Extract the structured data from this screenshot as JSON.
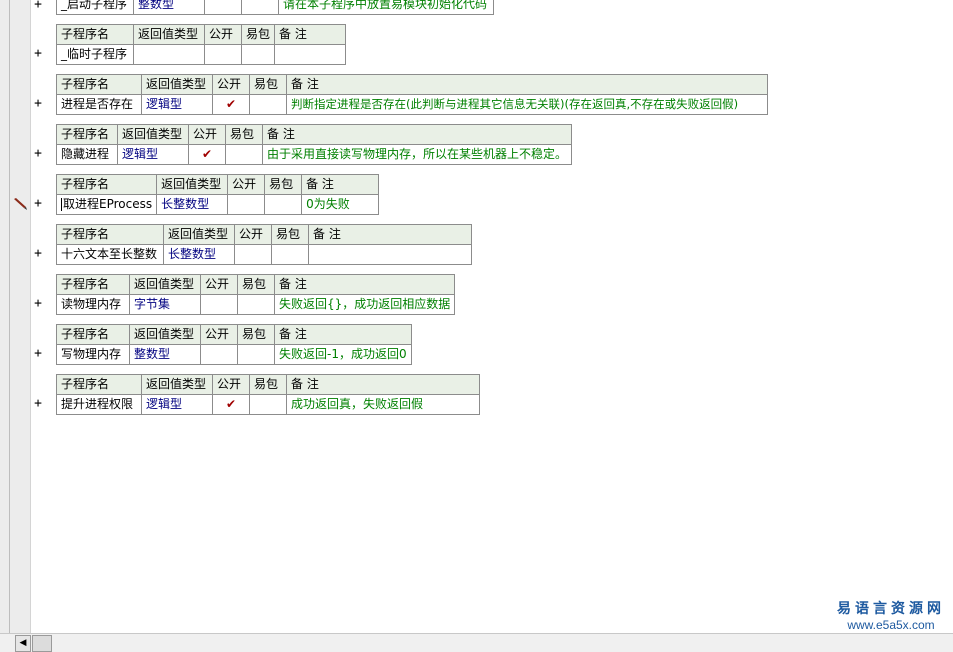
{
  "headers": {
    "name": "子程序名",
    "return_type": "返回值类型",
    "public": "公开",
    "easy_pack": "易包",
    "note": "备 注"
  },
  "expand_glyph": "+",
  "check_glyph": "✔",
  "subroutines": [
    {
      "name": "_启动子程序",
      "type": "整数型",
      "public": false,
      "note": "请在本子程序中放置易模块初始化代码"
    },
    {
      "name": "_临时子程序",
      "type": "",
      "public": false,
      "note": ""
    },
    {
      "name": "进程是否存在",
      "type": "逻辑型",
      "public": true,
      "note": "判断指定进程是否存在(此判断与进程其它信息无关联)(存在返回真,不存在或失败返回假)"
    },
    {
      "name": "隐藏进程",
      "type": "逻辑型",
      "public": true,
      "note": "由于采用直接读写物理内存，所以在某些机器上不稳定。"
    },
    {
      "name": "取进程EProcess",
      "type": "长整数型",
      "public": false,
      "note": "0为失败"
    },
    {
      "name": "十六文本至长整数",
      "type": "长整数型",
      "public": false,
      "note": ""
    },
    {
      "name": "读物理内存",
      "type": "字节集",
      "public": false,
      "note": "失败返回{}，成功返回相应数据"
    },
    {
      "name": "写物理内存",
      "type": "整数型",
      "public": false,
      "note": "失败返回-1，成功返回0"
    },
    {
      "name": "提升进程权限",
      "type": "逻辑型",
      "public": true,
      "note": "成功返回真，失败返回假"
    }
  ],
  "scroll_left_glyph": "◀",
  "watermark": {
    "title": "易语言资源网",
    "url": "www.e5a5x.com"
  },
  "colors": {
    "header_bg": "#e9f0e6",
    "type_text": "#000080",
    "note_text": "#008000",
    "check": "#a00000"
  }
}
